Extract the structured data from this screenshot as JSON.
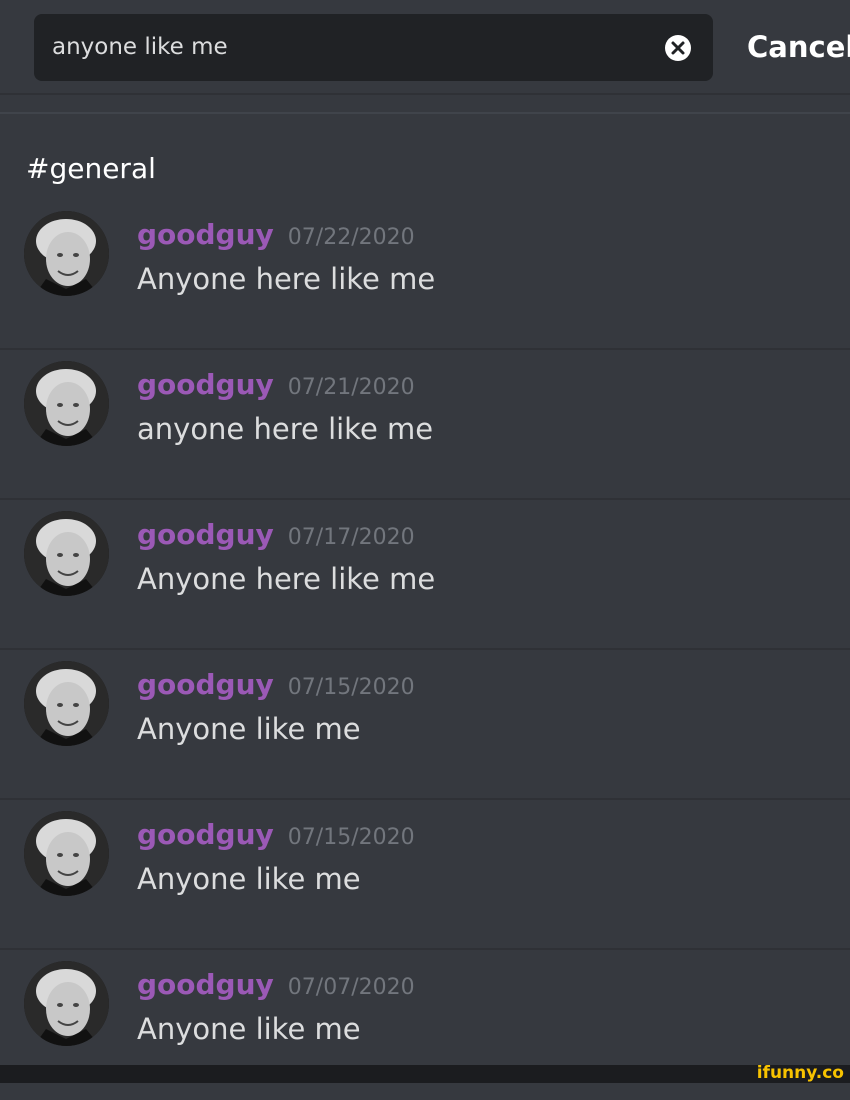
{
  "search": {
    "query": "anyone like me",
    "cancel_label": "Cancel",
    "clear_icon": "close-circle-icon"
  },
  "channel": {
    "title": "#general"
  },
  "colors": {
    "background": "#36393f",
    "search_background": "#202225",
    "username": "#9b59b6",
    "timestamp": "#72767d",
    "message_text": "#dcddde"
  },
  "results": [
    {
      "username": "goodguy",
      "timestamp": "07/22/2020",
      "text": "Anyone here like me"
    },
    {
      "username": "goodguy",
      "timestamp": "07/21/2020",
      "text": "anyone here like me"
    },
    {
      "username": "goodguy",
      "timestamp": "07/17/2020",
      "text": "Anyone here like me"
    },
    {
      "username": "goodguy",
      "timestamp": "07/15/2020",
      "text": "Anyone like me"
    },
    {
      "username": "goodguy",
      "timestamp": "07/15/2020",
      "text": "Anyone like me"
    },
    {
      "username": "goodguy",
      "timestamp": "07/07/2020",
      "text": "Anyone like me"
    }
  ],
  "watermark": "ifunny.co"
}
